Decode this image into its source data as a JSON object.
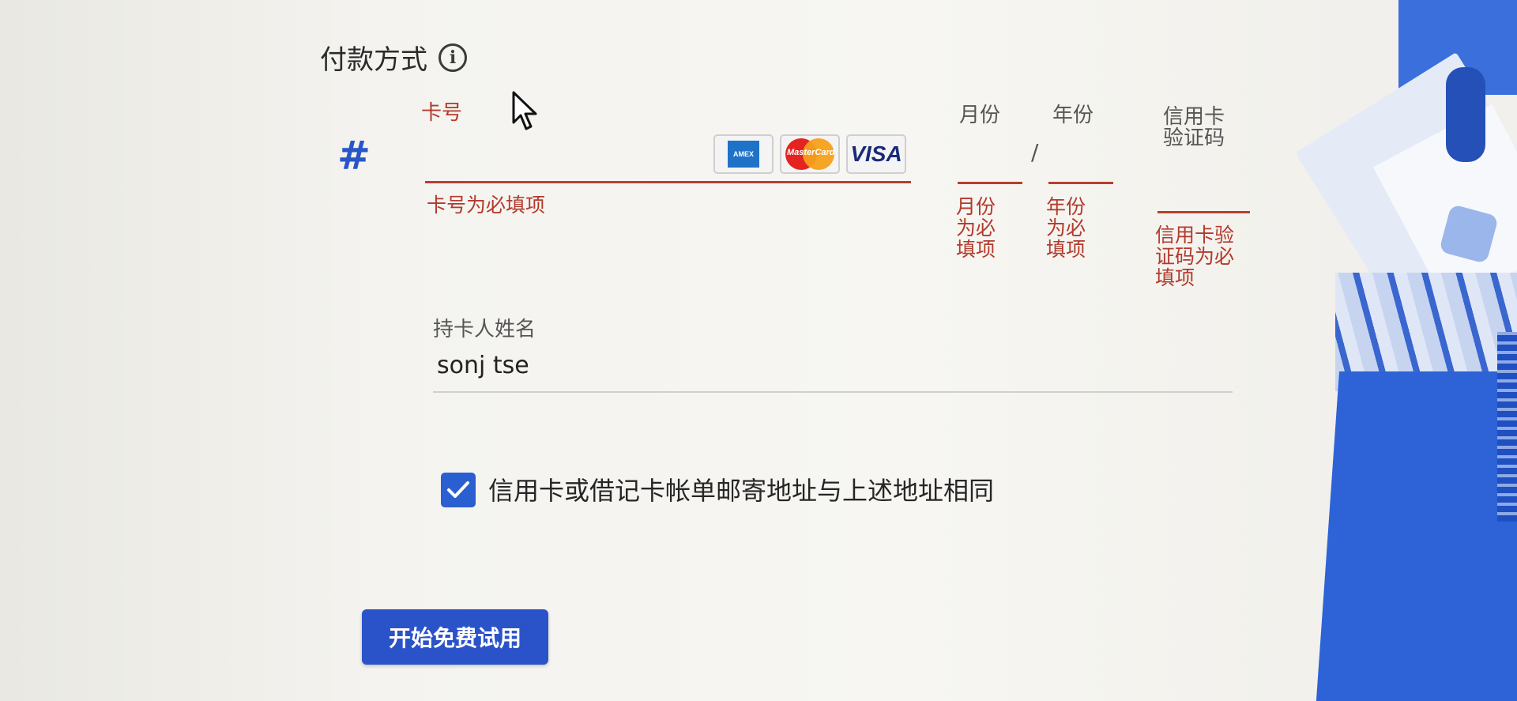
{
  "payment": {
    "title": "付款方式",
    "card_number": {
      "label": "卡号",
      "value": "",
      "error": "卡号为必填项",
      "card_brands": [
        "AMEX",
        "MasterCard",
        "VISA"
      ]
    },
    "expiry_month": {
      "label": "月份",
      "error_lines": [
        "月份",
        "为必",
        "填项"
      ]
    },
    "expiry_separator": "/",
    "expiry_year": {
      "label": "年份",
      "error_lines": [
        "年份",
        "为必",
        "填项"
      ]
    },
    "cvv": {
      "label_lines": [
        "信用卡",
        "验证码"
      ],
      "error_lines": [
        "信用卡验",
        "证码为必",
        "填项"
      ]
    },
    "cardholder": {
      "label": "持卡人姓名",
      "value": "sonj tse"
    },
    "billing_same": {
      "checked": true,
      "label": "信用卡或借记卡帐单邮寄地址与上述地址相同"
    },
    "submit_label": "开始免费试用"
  },
  "colors": {
    "error": "#b23a2c",
    "primary": "#2b53c9",
    "checkbox": "#2a5fd1"
  }
}
